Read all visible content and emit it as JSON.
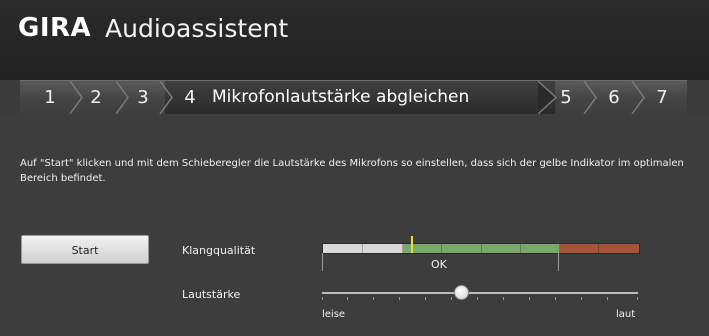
{
  "header": {
    "brand": "GIRA",
    "app_title": "Audioassistent"
  },
  "steps": {
    "before": [
      "1",
      "2",
      "3"
    ],
    "active_number": "4",
    "active_label": "Mikrofonlautstärke abgleichen",
    "after": [
      "5",
      "6",
      "7"
    ]
  },
  "instruction": "Auf \"Start\" klicken und mit dem Schieberegler die Lautstärke des Mikrofons so einstellen, dass sich der gelbe Indikator im optimalen Bereich befindet.",
  "start_label": "Start",
  "quality": {
    "label": "Klangqualität",
    "status": "OK",
    "zone_colors": {
      "low": "#d9d9d9",
      "optimal": "#7aa86a",
      "high": "#a7533a"
    },
    "indicator_color": "#e6df3a"
  },
  "volume": {
    "label": "Lautstärke",
    "min_label": "leise",
    "max_label": "laut",
    "level": 0.44
  }
}
